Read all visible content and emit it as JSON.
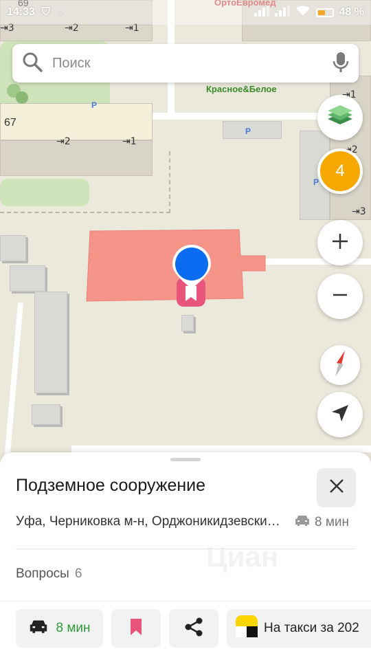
{
  "status_bar": {
    "time": "14:33",
    "battery": "48 %",
    "battery_level": 0.48
  },
  "map": {
    "poi_top": "ОртоЕвромед",
    "poi_shop": "Красное&Белое",
    "building_numbers": [
      "69",
      "67"
    ],
    "entrances": [
      "3",
      "2",
      "1",
      "2",
      "1",
      "1",
      "2",
      "3"
    ],
    "parking": "P"
  },
  "search": {
    "placeholder": "Поиск"
  },
  "controls": {
    "traffic_level": "4",
    "traffic_color": "#f6a800",
    "marker_color": "#0a6cf0",
    "zone_color": "#f5958a"
  },
  "place": {
    "title": "Подземное сооружение",
    "address": "Уфа, Черниковка м-н, Орджоникидзевский район",
    "eta": "8 мин",
    "questions_label": "Вопросы",
    "questions_count": "6"
  },
  "actions": {
    "route_label": "8 мин",
    "taxi_label": "На такси за 202"
  }
}
